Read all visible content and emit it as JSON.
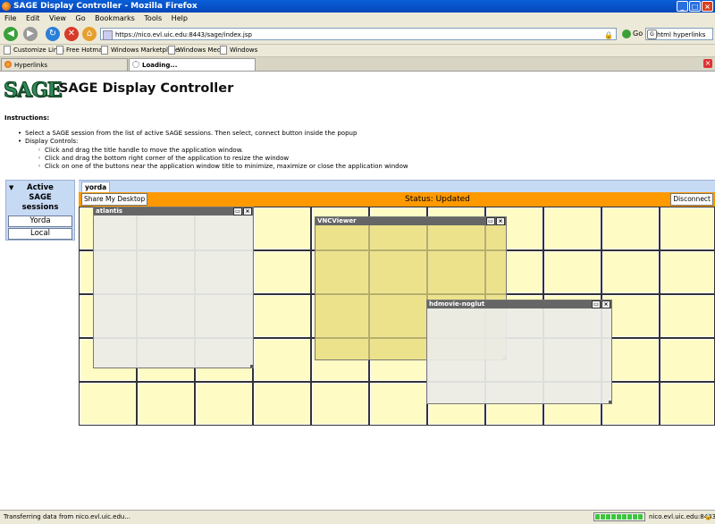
{
  "browser": {
    "title": "SAGE Display Controller - Mozilla Firefox",
    "menu": [
      "File",
      "Edit",
      "View",
      "Go",
      "Bookmarks",
      "Tools",
      "Help"
    ],
    "url": "https://nico.evl.uic.edu:8443/sage/index.jsp",
    "go_label": "Go",
    "search_value": "html hyperlinks",
    "bookmarks": [
      "Customize Links",
      "Free Hotmail",
      "Windows Marketplace",
      "Windows Media",
      "Windows"
    ],
    "tabs": [
      {
        "label": "Hyperlinks"
      },
      {
        "label": "Loading..."
      }
    ],
    "status_text": "Transferring data from nico.evl.uic.edu...",
    "status_host": "nico.evl.uic.edu:8443",
    "progress": 1.0
  },
  "page": {
    "logo_text": "SAGE",
    "title": "SAGE Display Controller",
    "instructions_heading": "Instructions:",
    "instructions": {
      "item1": "Select a SAGE session from the list of active SAGE sessions. Then select, connect button inside the popup",
      "item2": "Display Controls:",
      "sub1": "Click and drag the title handle to move the application window.",
      "sub2": "Click and drag the bottom right corner of the application to resize the window",
      "sub3": "Click on one of the buttons near the application window title to minimize, maximize or close the application window"
    }
  },
  "sessions": {
    "heading": "Active SAGE sessions",
    "items": [
      "Yorda",
      "Local"
    ]
  },
  "display": {
    "tab_label": "yorda",
    "share_button": "Share My Desktop",
    "status": "Status: Updated",
    "disconnect_button": "Disconnect",
    "apps": [
      {
        "name": "atlantis"
      },
      {
        "name": "VNCViewer"
      },
      {
        "name": "hdmovie-noglut"
      }
    ]
  },
  "colors": {
    "accent_orange": "#ff9900",
    "panel_blue": "#c7daf4",
    "tile_yellow": "#fefcc4",
    "logo_green": "#2e8b57"
  }
}
